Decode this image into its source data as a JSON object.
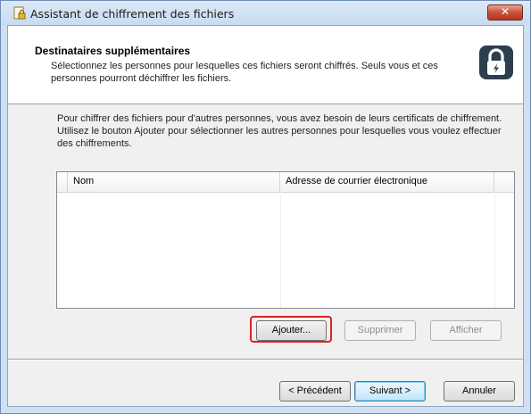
{
  "window": {
    "title": "Assistant de chiffrement des fichiers",
    "close_label": "✕"
  },
  "header": {
    "title": "Destinataires supplémentaires",
    "subtitle": "Sélectionnez les personnes pour lesquelles ces fichiers seront chiffrés. Seuls vous et ces personnes pourront déchiffrer les fichiers.",
    "icon": "lock-icon"
  },
  "intro_text": "Pour chiffrer des fichiers pour d'autres personnes, vous avez besoin de leurs certificats de chiffrement. Utilisez le bouton Ajouter pour sélectionner les autres personnes pour lesquelles vous voulez effectuer des chiffrements.",
  "list": {
    "columns": [
      "Nom",
      "Adresse de courrier électronique"
    ],
    "rows": []
  },
  "list_buttons": {
    "add_prefix": "A",
    "add_accel": "j",
    "add_rest": "outer...",
    "remove": "Supprimer",
    "show": "Afficher"
  },
  "footer": {
    "back": "< Précédent",
    "next": "Suivant >",
    "cancel": "Annuler"
  },
  "colors": {
    "highlight": "#e02020",
    "title_bar": "#c7dbf1"
  }
}
